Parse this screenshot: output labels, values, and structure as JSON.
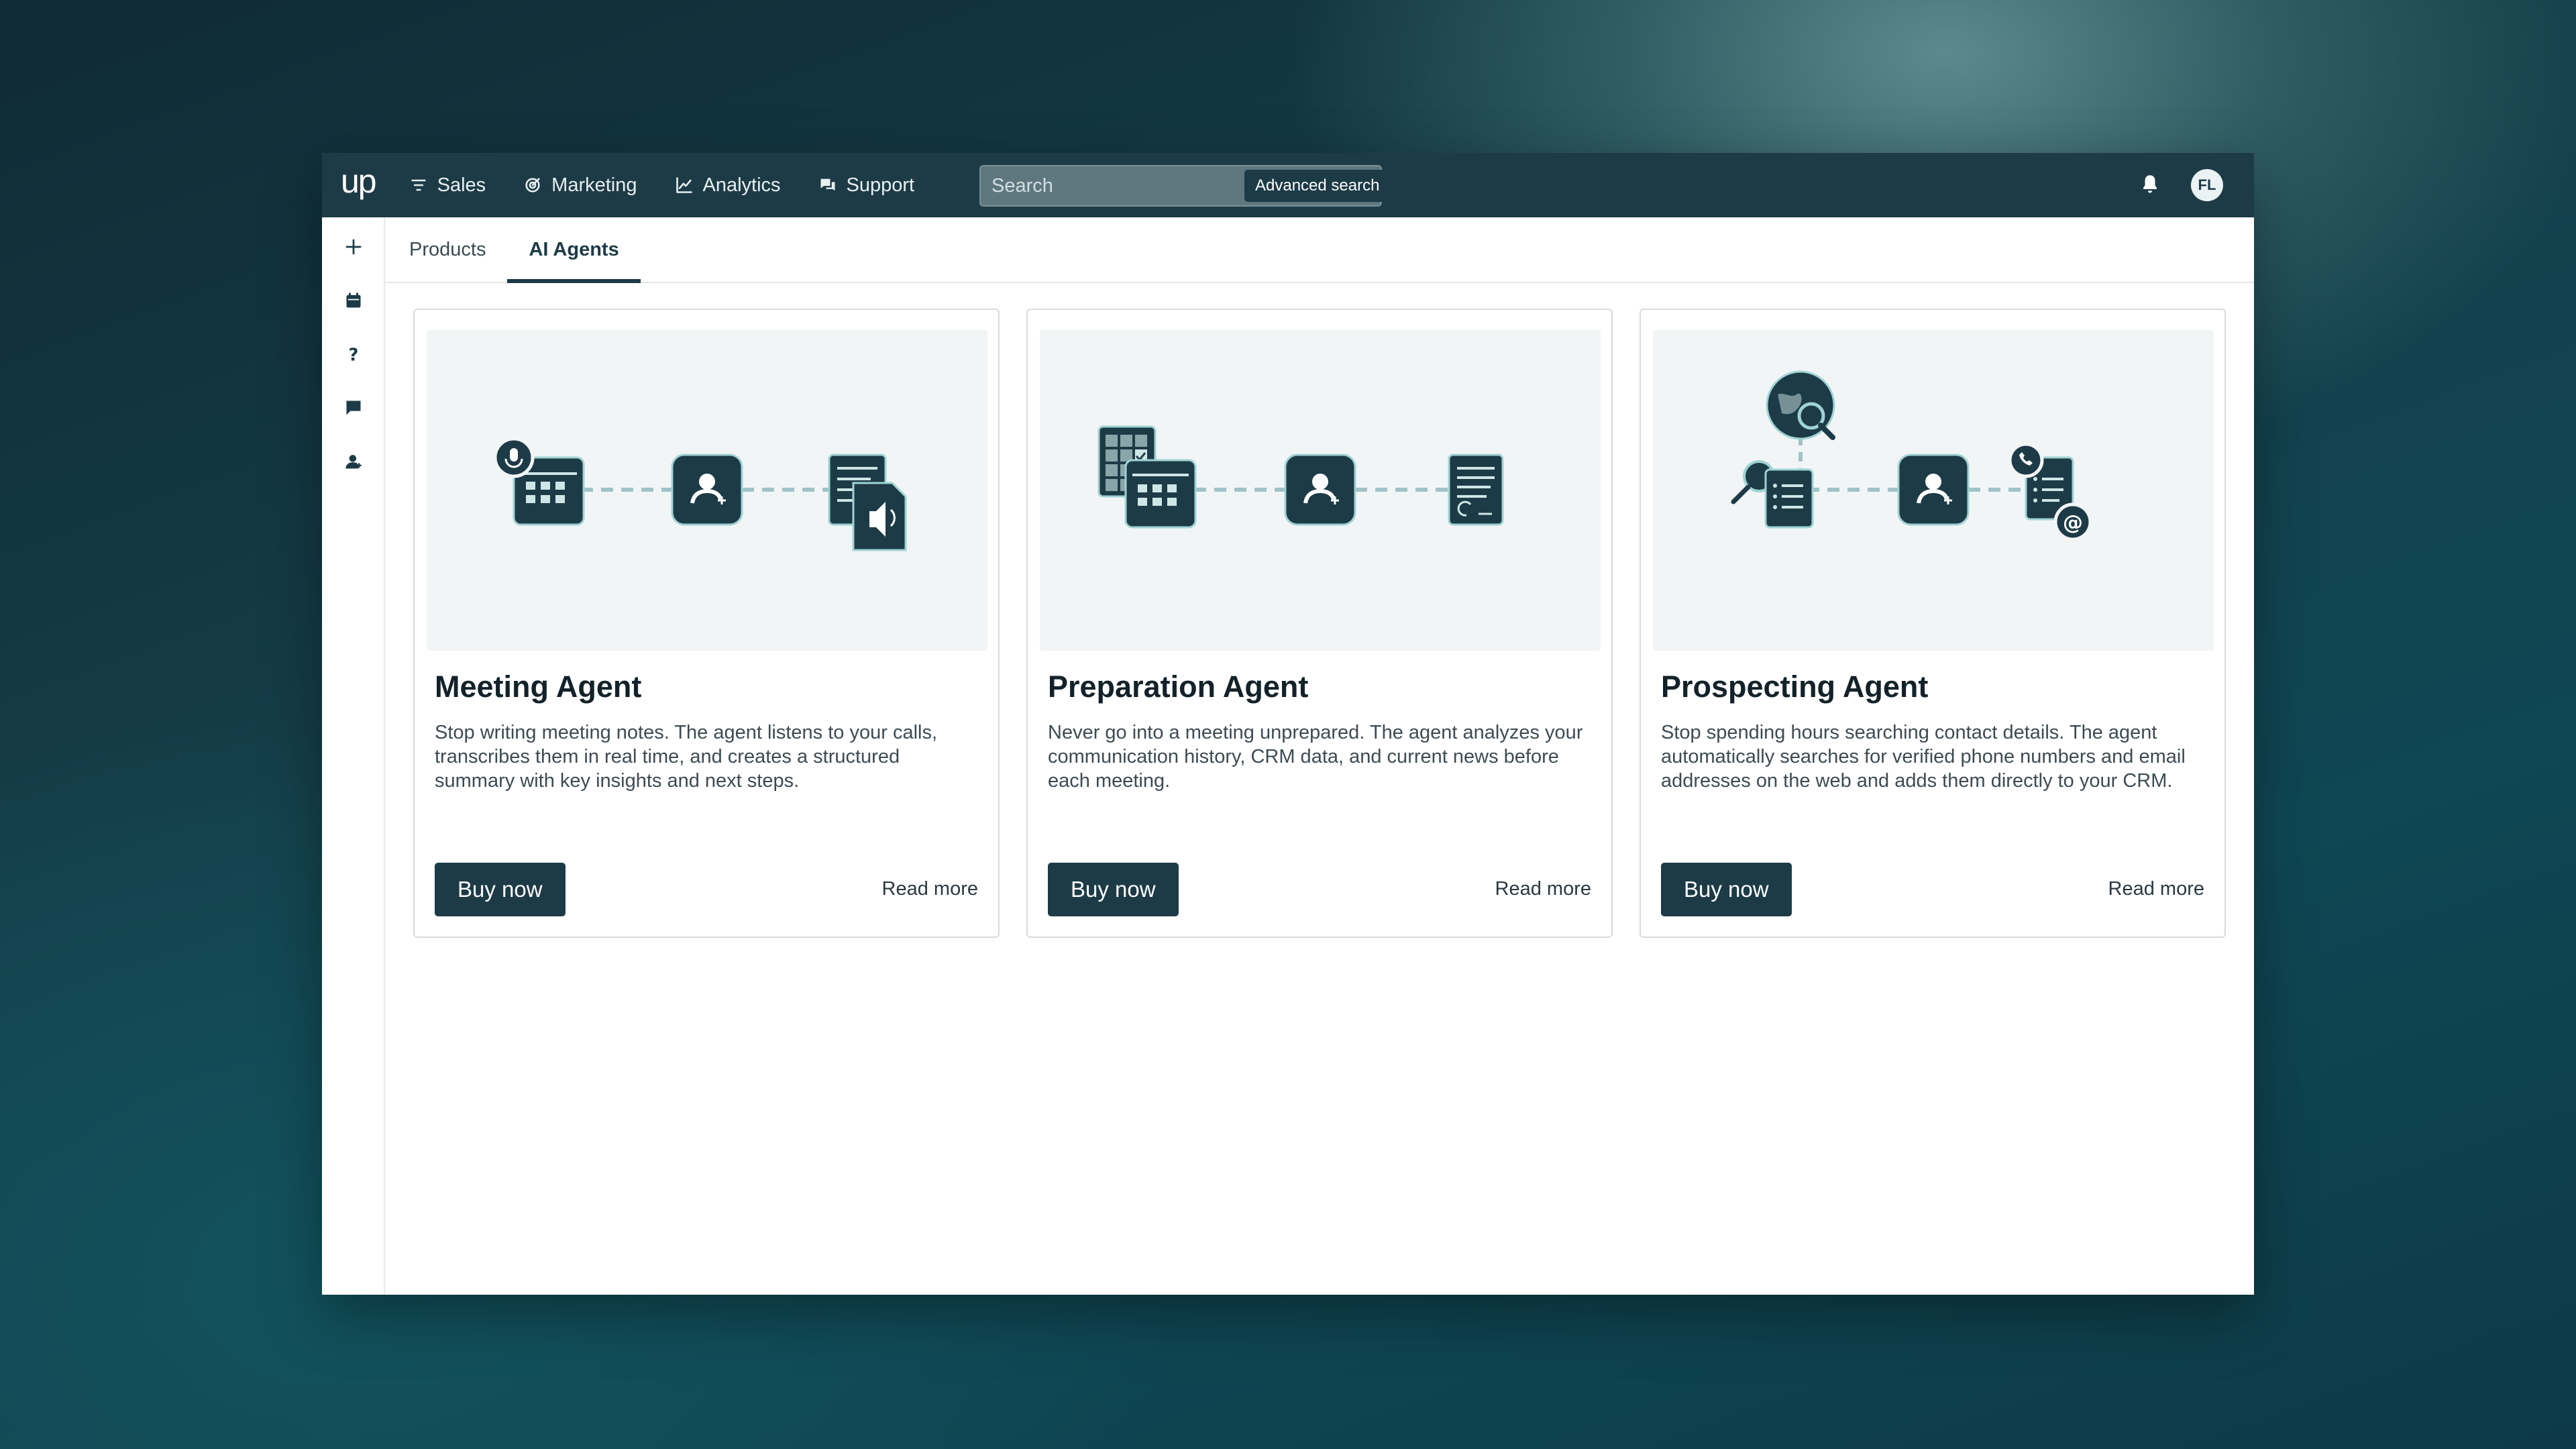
{
  "app": {
    "logo_text": "up",
    "nav": [
      {
        "label": "Sales",
        "icon": "filter-icon"
      },
      {
        "label": "Marketing",
        "icon": "target-icon"
      },
      {
        "label": "Analytics",
        "icon": "trend-chart-icon"
      },
      {
        "label": "Support",
        "icon": "chat-bubbles-icon"
      }
    ],
    "search": {
      "placeholder": "Search",
      "advanced_label": "Advanced search"
    },
    "user_initials": "FL"
  },
  "sidebar": {
    "icons": [
      "plus-icon",
      "calendar-icon",
      "help-icon",
      "comment-icon",
      "user-icon"
    ]
  },
  "tabs": [
    {
      "label": "Products",
      "active": false
    },
    {
      "label": "AI Agents",
      "active": true
    }
  ],
  "cards": [
    {
      "title": "Meeting Agent",
      "description": "Stop writing meeting notes. The agent listens to your calls, transcribes them in real time, and creates a structured summary with key insights and next steps.",
      "buy_label": "Buy now",
      "read_more_label": "Read more"
    },
    {
      "title": "Preparation Agent",
      "description": "Never go into a meeting unprepared. The agent analyzes your communication history, CRM data, and current news before each meeting.",
      "buy_label": "Buy now",
      "read_more_label": "Read more"
    },
    {
      "title": "Prospecting Agent",
      "description": "Stop spending hours searching contact details. The agent automatically searches for verified phone numbers and email addresses on the web and adds them directly to your CRM.",
      "buy_label": "Buy now",
      "read_more_label": "Read more"
    }
  ],
  "colors": {
    "primary": "#1d3b47",
    "accent": "#9fd3d3",
    "illustration_bg": "#f2f5f6"
  }
}
